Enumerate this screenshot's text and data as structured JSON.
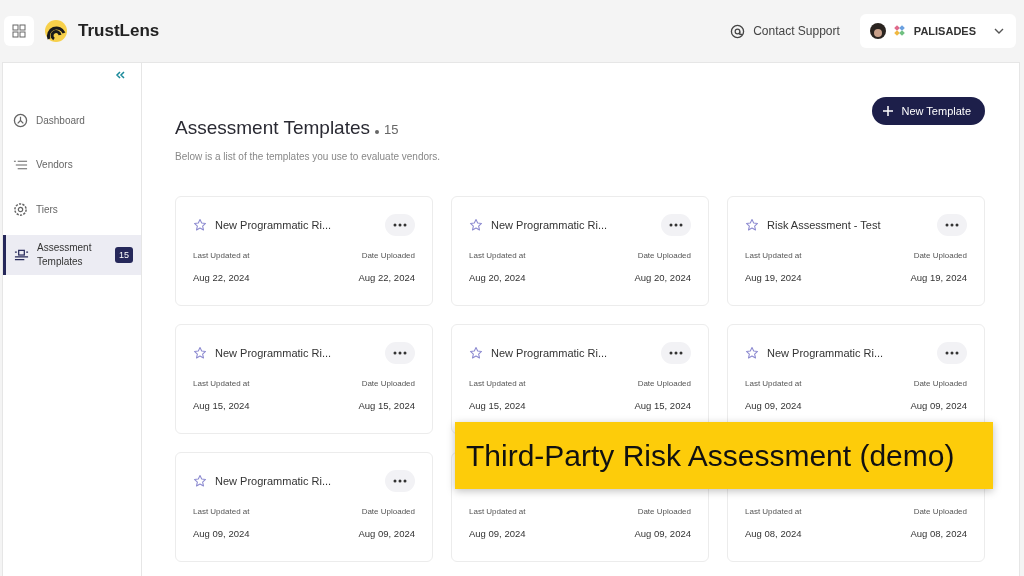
{
  "header": {
    "app_name": "TrustLens",
    "support": "Contact Support",
    "org": "PALISADES"
  },
  "sidebar": {
    "items": [
      {
        "label": "Dashboard",
        "selected": false
      },
      {
        "label": "Vendors",
        "selected": false
      },
      {
        "label": "Tiers",
        "selected": false
      },
      {
        "label": "Assessment Templates",
        "selected": true,
        "badge": "15"
      }
    ]
  },
  "page": {
    "title": "Assessment Templates",
    "count": "15",
    "subtitle": "Below is a list of the templates you use to evaluate vendors.",
    "new_button": "New Template"
  },
  "cards": [
    {
      "title": "New Programmatic Ri...",
      "updated_label": "Last Updated at",
      "uploaded_label": "Date Uploaded",
      "updated": "Aug 22, 2024",
      "uploaded": "Aug 22, 2024"
    },
    {
      "title": "New Programmatic Ri...",
      "updated_label": "Last Updated at",
      "uploaded_label": "Date Uploaded",
      "updated": "Aug 20, 2024",
      "uploaded": "Aug 20, 2024"
    },
    {
      "title": "Risk Assessment - Test",
      "updated_label": "Last Updated at",
      "uploaded_label": "Date Uploaded",
      "updated": "Aug 19, 2024",
      "uploaded": "Aug 19, 2024"
    },
    {
      "title": "New Programmatic Ri...",
      "updated_label": "Last Updated at",
      "uploaded_label": "Date Uploaded",
      "updated": "Aug 15, 2024",
      "uploaded": "Aug 15, 2024"
    },
    {
      "title": "New Programmatic Ri...",
      "updated_label": "Last Updated at",
      "uploaded_label": "Date Uploaded",
      "updated": "Aug 15, 2024",
      "uploaded": "Aug 15, 2024"
    },
    {
      "title": "New Programmatic Ri...",
      "updated_label": "Last Updated at",
      "uploaded_label": "Date Uploaded",
      "updated": "Aug 09, 2024",
      "uploaded": "Aug 09, 2024"
    },
    {
      "title": "New Programmatic Ri...",
      "updated_label": "Last Updated at",
      "uploaded_label": "Date Uploaded",
      "updated": "Aug 09, 2024",
      "uploaded": "Aug 09, 2024"
    },
    {
      "updated_label": "Last Updated at",
      "uploaded_label": "Date Uploaded",
      "updated": "Aug 09, 2024",
      "uploaded": "Aug 09, 2024"
    },
    {
      "updated_label": "Last Updated at",
      "uploaded_label": "Date Uploaded",
      "updated": "Aug 08, 2024",
      "uploaded": "Aug 08, 2024"
    }
  ],
  "caption": "Third-Party Risk Assessment (demo)"
}
